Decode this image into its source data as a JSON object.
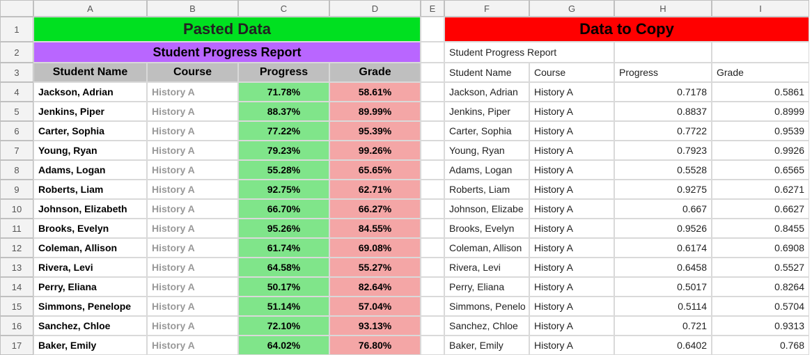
{
  "columns": [
    "A",
    "B",
    "C",
    "D",
    "E",
    "F",
    "G",
    "H",
    "I"
  ],
  "row_headers": [
    "1",
    "2",
    "3",
    "4",
    "5",
    "6",
    "7",
    "8",
    "9",
    "10",
    "11",
    "12",
    "13",
    "14",
    "15",
    "16",
    "17"
  ],
  "titles": {
    "pasted": "Pasted Data",
    "copy": "Data to Copy",
    "subtitle_left": "Student Progress Report",
    "subtitle_right": "Student Progress Report"
  },
  "headers_left": {
    "name": "Student Name",
    "course": "Course",
    "progress": "Progress",
    "grade": "Grade"
  },
  "headers_right": {
    "name": "Student Name",
    "course": "Course",
    "progress": "Progress",
    "grade": "Grade"
  },
  "rows": [
    {
      "name": "Jackson, Adrian",
      "course": "History A",
      "progress_pct": "71.78%",
      "grade_pct": "58.61%",
      "r_name": "Jackson, Adrian",
      "r_course": "History A",
      "r_progress": "0.7178",
      "r_grade": "0.5861"
    },
    {
      "name": "Jenkins, Piper",
      "course": "History A",
      "progress_pct": "88.37%",
      "grade_pct": "89.99%",
      "r_name": "Jenkins, Piper",
      "r_course": "History A",
      "r_progress": "0.8837",
      "r_grade": "0.8999"
    },
    {
      "name": "Carter, Sophia",
      "course": "History A",
      "progress_pct": "77.22%",
      "grade_pct": "95.39%",
      "r_name": "Carter, Sophia",
      "r_course": "History A",
      "r_progress": "0.7722",
      "r_grade": "0.9539"
    },
    {
      "name": "Young, Ryan",
      "course": "History A",
      "progress_pct": "79.23%",
      "grade_pct": "99.26%",
      "r_name": "Young, Ryan",
      "r_course": "History A",
      "r_progress": "0.7923",
      "r_grade": "0.9926"
    },
    {
      "name": "Adams, Logan",
      "course": "History A",
      "progress_pct": "55.28%",
      "grade_pct": "65.65%",
      "r_name": "Adams, Logan",
      "r_course": "History A",
      "r_progress": "0.5528",
      "r_grade": "0.6565"
    },
    {
      "name": "Roberts, Liam",
      "course": "History A",
      "progress_pct": "92.75%",
      "grade_pct": "62.71%",
      "r_name": "Roberts, Liam",
      "r_course": "History A",
      "r_progress": "0.9275",
      "r_grade": "0.6271"
    },
    {
      "name": "Johnson, Elizabeth",
      "course": "History A",
      "progress_pct": "66.70%",
      "grade_pct": "66.27%",
      "r_name": "Johnson, Elizabe",
      "r_course": "History A",
      "r_progress": "0.667",
      "r_grade": "0.6627"
    },
    {
      "name": "Brooks, Evelyn",
      "course": "History A",
      "progress_pct": "95.26%",
      "grade_pct": "84.55%",
      "r_name": "Brooks, Evelyn",
      "r_course": "History A",
      "r_progress": "0.9526",
      "r_grade": "0.8455"
    },
    {
      "name": "Coleman, Allison",
      "course": "History A",
      "progress_pct": "61.74%",
      "grade_pct": "69.08%",
      "r_name": "Coleman, Allison",
      "r_course": "History A",
      "r_progress": "0.6174",
      "r_grade": "0.6908"
    },
    {
      "name": "Rivera, Levi",
      "course": "History A",
      "progress_pct": "64.58%",
      "grade_pct": "55.27%",
      "r_name": "Rivera, Levi",
      "r_course": "History A",
      "r_progress": "0.6458",
      "r_grade": "0.5527"
    },
    {
      "name": "Perry, Eliana",
      "course": "History A",
      "progress_pct": "50.17%",
      "grade_pct": "82.64%",
      "r_name": "Perry, Eliana",
      "r_course": "History A",
      "r_progress": "0.5017",
      "r_grade": "0.8264"
    },
    {
      "name": "Simmons, Penelope",
      "course": "History A",
      "progress_pct": "51.14%",
      "grade_pct": "57.04%",
      "r_name": "Simmons, Penelo",
      "r_course": "History A",
      "r_progress": "0.5114",
      "r_grade": "0.5704"
    },
    {
      "name": "Sanchez, Chloe",
      "course": "History A",
      "progress_pct": "72.10%",
      "grade_pct": "93.13%",
      "r_name": "Sanchez, Chloe",
      "r_course": "History A",
      "r_progress": "0.721",
      "r_grade": "0.9313"
    },
    {
      "name": "Baker, Emily",
      "course": "History A",
      "progress_pct": "64.02%",
      "grade_pct": "76.80%",
      "r_name": "Baker, Emily",
      "r_course": "History A",
      "r_progress": "0.6402",
      "r_grade": "0.768"
    }
  ]
}
